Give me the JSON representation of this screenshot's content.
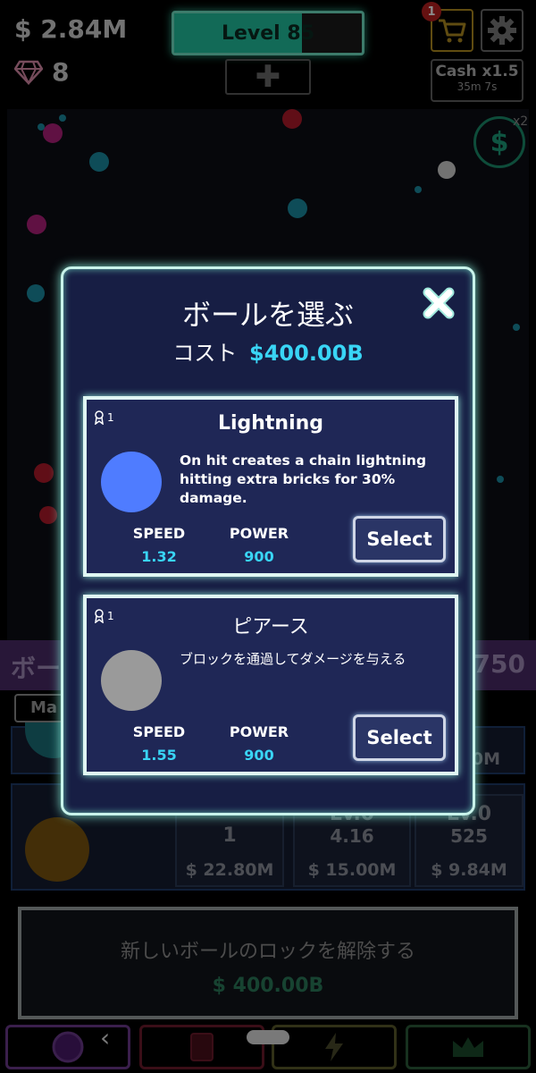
{
  "hud": {
    "cash": "$ 2.84M",
    "gems": "8",
    "level_label": "Level 85",
    "level_progress": 0.68,
    "plus_label": "✚",
    "cart_badge": "1",
    "boost_title": "Cash x1.5",
    "boost_timer": "35m 7s",
    "coin_symbol": "$",
    "coin_multiplier": "x2"
  },
  "lower": {
    "header_title": "ボー",
    "header_count": "750",
    "max_tab": "Ma",
    "row2": {
      "cells": [
        {
          "line1": "1",
          "line2": "",
          "price": "$ 22.80M"
        },
        {
          "line1": "Lv.0",
          "line2": "4.16",
          "price": "$ 15.00M"
        },
        {
          "line1": "Lv.0",
          "line2": "525",
          "price": "$ 9.84M"
        }
      ]
    },
    "row1_right": "0M",
    "unlock_text": "新しいボールのロックを解除する",
    "unlock_price": "$ 400.00B"
  },
  "modal": {
    "title": "ボールを選ぶ",
    "cost_label": "コスト",
    "cost_value": "$400.00B",
    "balls": [
      {
        "name": "Lightning",
        "rank": "1",
        "color": "#4f7cff",
        "description": "On hit creates a chain lightning hitting extra bricks for 30% damage.",
        "speed_label": "SPEED",
        "speed": "1.32",
        "power_label": "POWER",
        "power": "900",
        "select_label": "Select"
      },
      {
        "name": "ピアース",
        "rank": "1",
        "color": "#9a9a9a",
        "description": "ブロックを通過してダメージを与える",
        "speed_label": "SPEED",
        "speed": "1.55",
        "power_label": "POWER",
        "power": "900",
        "select_label": "Select"
      }
    ]
  },
  "colors": {
    "accent_cyan": "#39d5f5",
    "modal_bg": "#171e44",
    "card_bg": "#1f2756",
    "level_fill": "#22c19e"
  },
  "icons": [
    "diamond-icon",
    "cart-icon",
    "gear-icon",
    "close-icon",
    "rank-medal-icon",
    "coin-icon",
    "circle-ball-icon",
    "card-icon",
    "lightning-icon",
    "crown-icon"
  ]
}
